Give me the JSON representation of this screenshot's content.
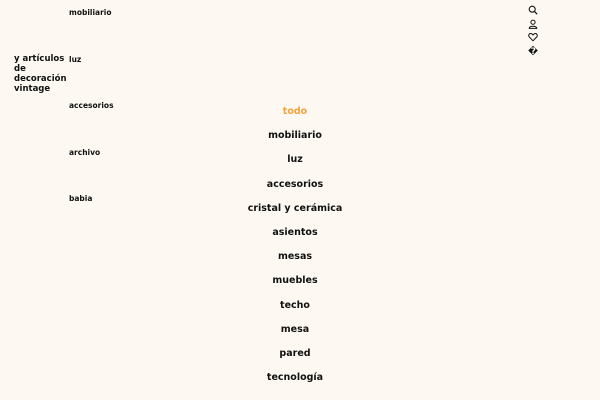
{
  "brand": {
    "lines": [
      "y artículos",
      "de",
      "decoración",
      "vintage"
    ]
  },
  "topnav": [
    "mobiliario",
    "luz",
    "accesorios",
    "archivo",
    "babia"
  ],
  "icons": {
    "search": "search-icon",
    "account": "user-icon",
    "wishlist": "heart-icon",
    "cart_glyph": "�"
  },
  "categories": [
    "todo",
    "mobiliario",
    "luz",
    "accesorios",
    "cristal y cerámica",
    "asientos",
    "mesas",
    "muebles",
    "techo",
    "mesa",
    "pared",
    "tecnología"
  ],
  "colors": {
    "background": "#fdf9f2",
    "text": "#111111",
    "active_category": "#f2a33a"
  }
}
